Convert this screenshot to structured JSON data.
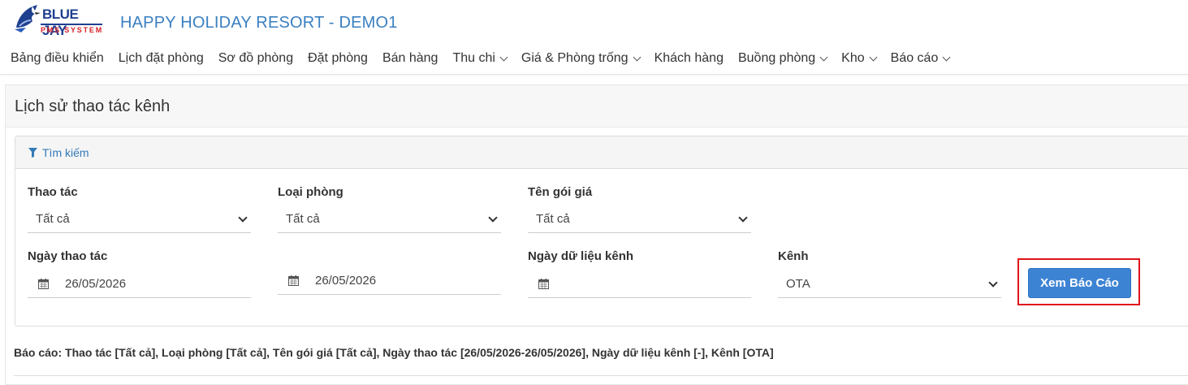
{
  "app": {
    "logo_text": "BLUE JAY",
    "logo_sub": "PMS SYSTEM",
    "hotel_name": "HAPPY HOLIDAY RESORT - DEMO1"
  },
  "nav": {
    "items": [
      {
        "label": "Bảng điều khiển",
        "dropdown": false
      },
      {
        "label": "Lịch đặt phòng",
        "dropdown": false
      },
      {
        "label": "Sơ đồ phòng",
        "dropdown": false
      },
      {
        "label": "Đặt phòng",
        "dropdown": false
      },
      {
        "label": "Bán hàng",
        "dropdown": false
      },
      {
        "label": "Thu chi",
        "dropdown": true
      },
      {
        "label": "Giá & Phòng trống",
        "dropdown": true
      },
      {
        "label": "Khách hàng",
        "dropdown": false
      },
      {
        "label": "Buồng phòng",
        "dropdown": true
      },
      {
        "label": "Kho",
        "dropdown": true
      },
      {
        "label": "Báo cáo",
        "dropdown": true
      }
    ]
  },
  "page": {
    "title": "Lịch sử thao tác kênh"
  },
  "search": {
    "header_label": "Tìm kiếm",
    "thao_tac": {
      "label": "Thao tác",
      "value": "Tất cả"
    },
    "loai_phong": {
      "label": "Loại phòng",
      "value": "Tất cả"
    },
    "ten_goi_gia": {
      "label": "Tên gói giá",
      "value": "Tất cả"
    },
    "ngay_thao_tac": {
      "label": "Ngày thao tác",
      "from": "26/05/2026",
      "to": "26/05/2026"
    },
    "ngay_du_lieu_kenh": {
      "label": "Ngày dữ liệu kênh",
      "value": ""
    },
    "kenh": {
      "label": "Kênh",
      "value": "OTA"
    },
    "submit_label": "Xem Báo Cáo"
  },
  "report": {
    "summary": "Báo cáo: Thao tác [Tất cả], Loại phòng [Tất cả], Tên gói giá [Tất cả], Ngày thao tác [26/05/2026-26/05/2026], Ngày dữ liệu kênh [-], Kênh [OTA]"
  },
  "colors": {
    "brand": "#1f3f8f",
    "accent": "#3d83d4",
    "hotel_name": "#3a7fc1",
    "highlight": "#e0121b"
  }
}
